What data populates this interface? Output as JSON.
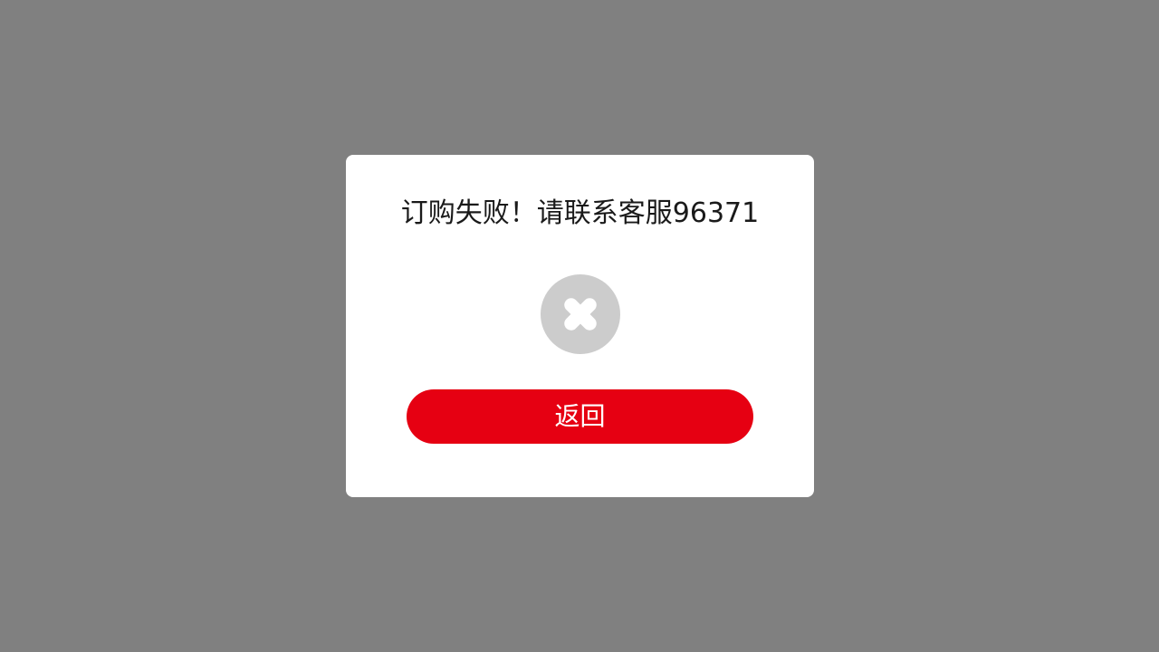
{
  "dialog": {
    "message": "订购失败！请联系客服96371",
    "icon": "close-icon",
    "return_label": "返回"
  },
  "colors": {
    "overlay": "#808080",
    "dialog_bg": "#ffffff",
    "icon_circle": "#cccccc",
    "button_bg": "#e60012",
    "button_text": "#ffffff",
    "message_text": "#1a1a1a"
  }
}
